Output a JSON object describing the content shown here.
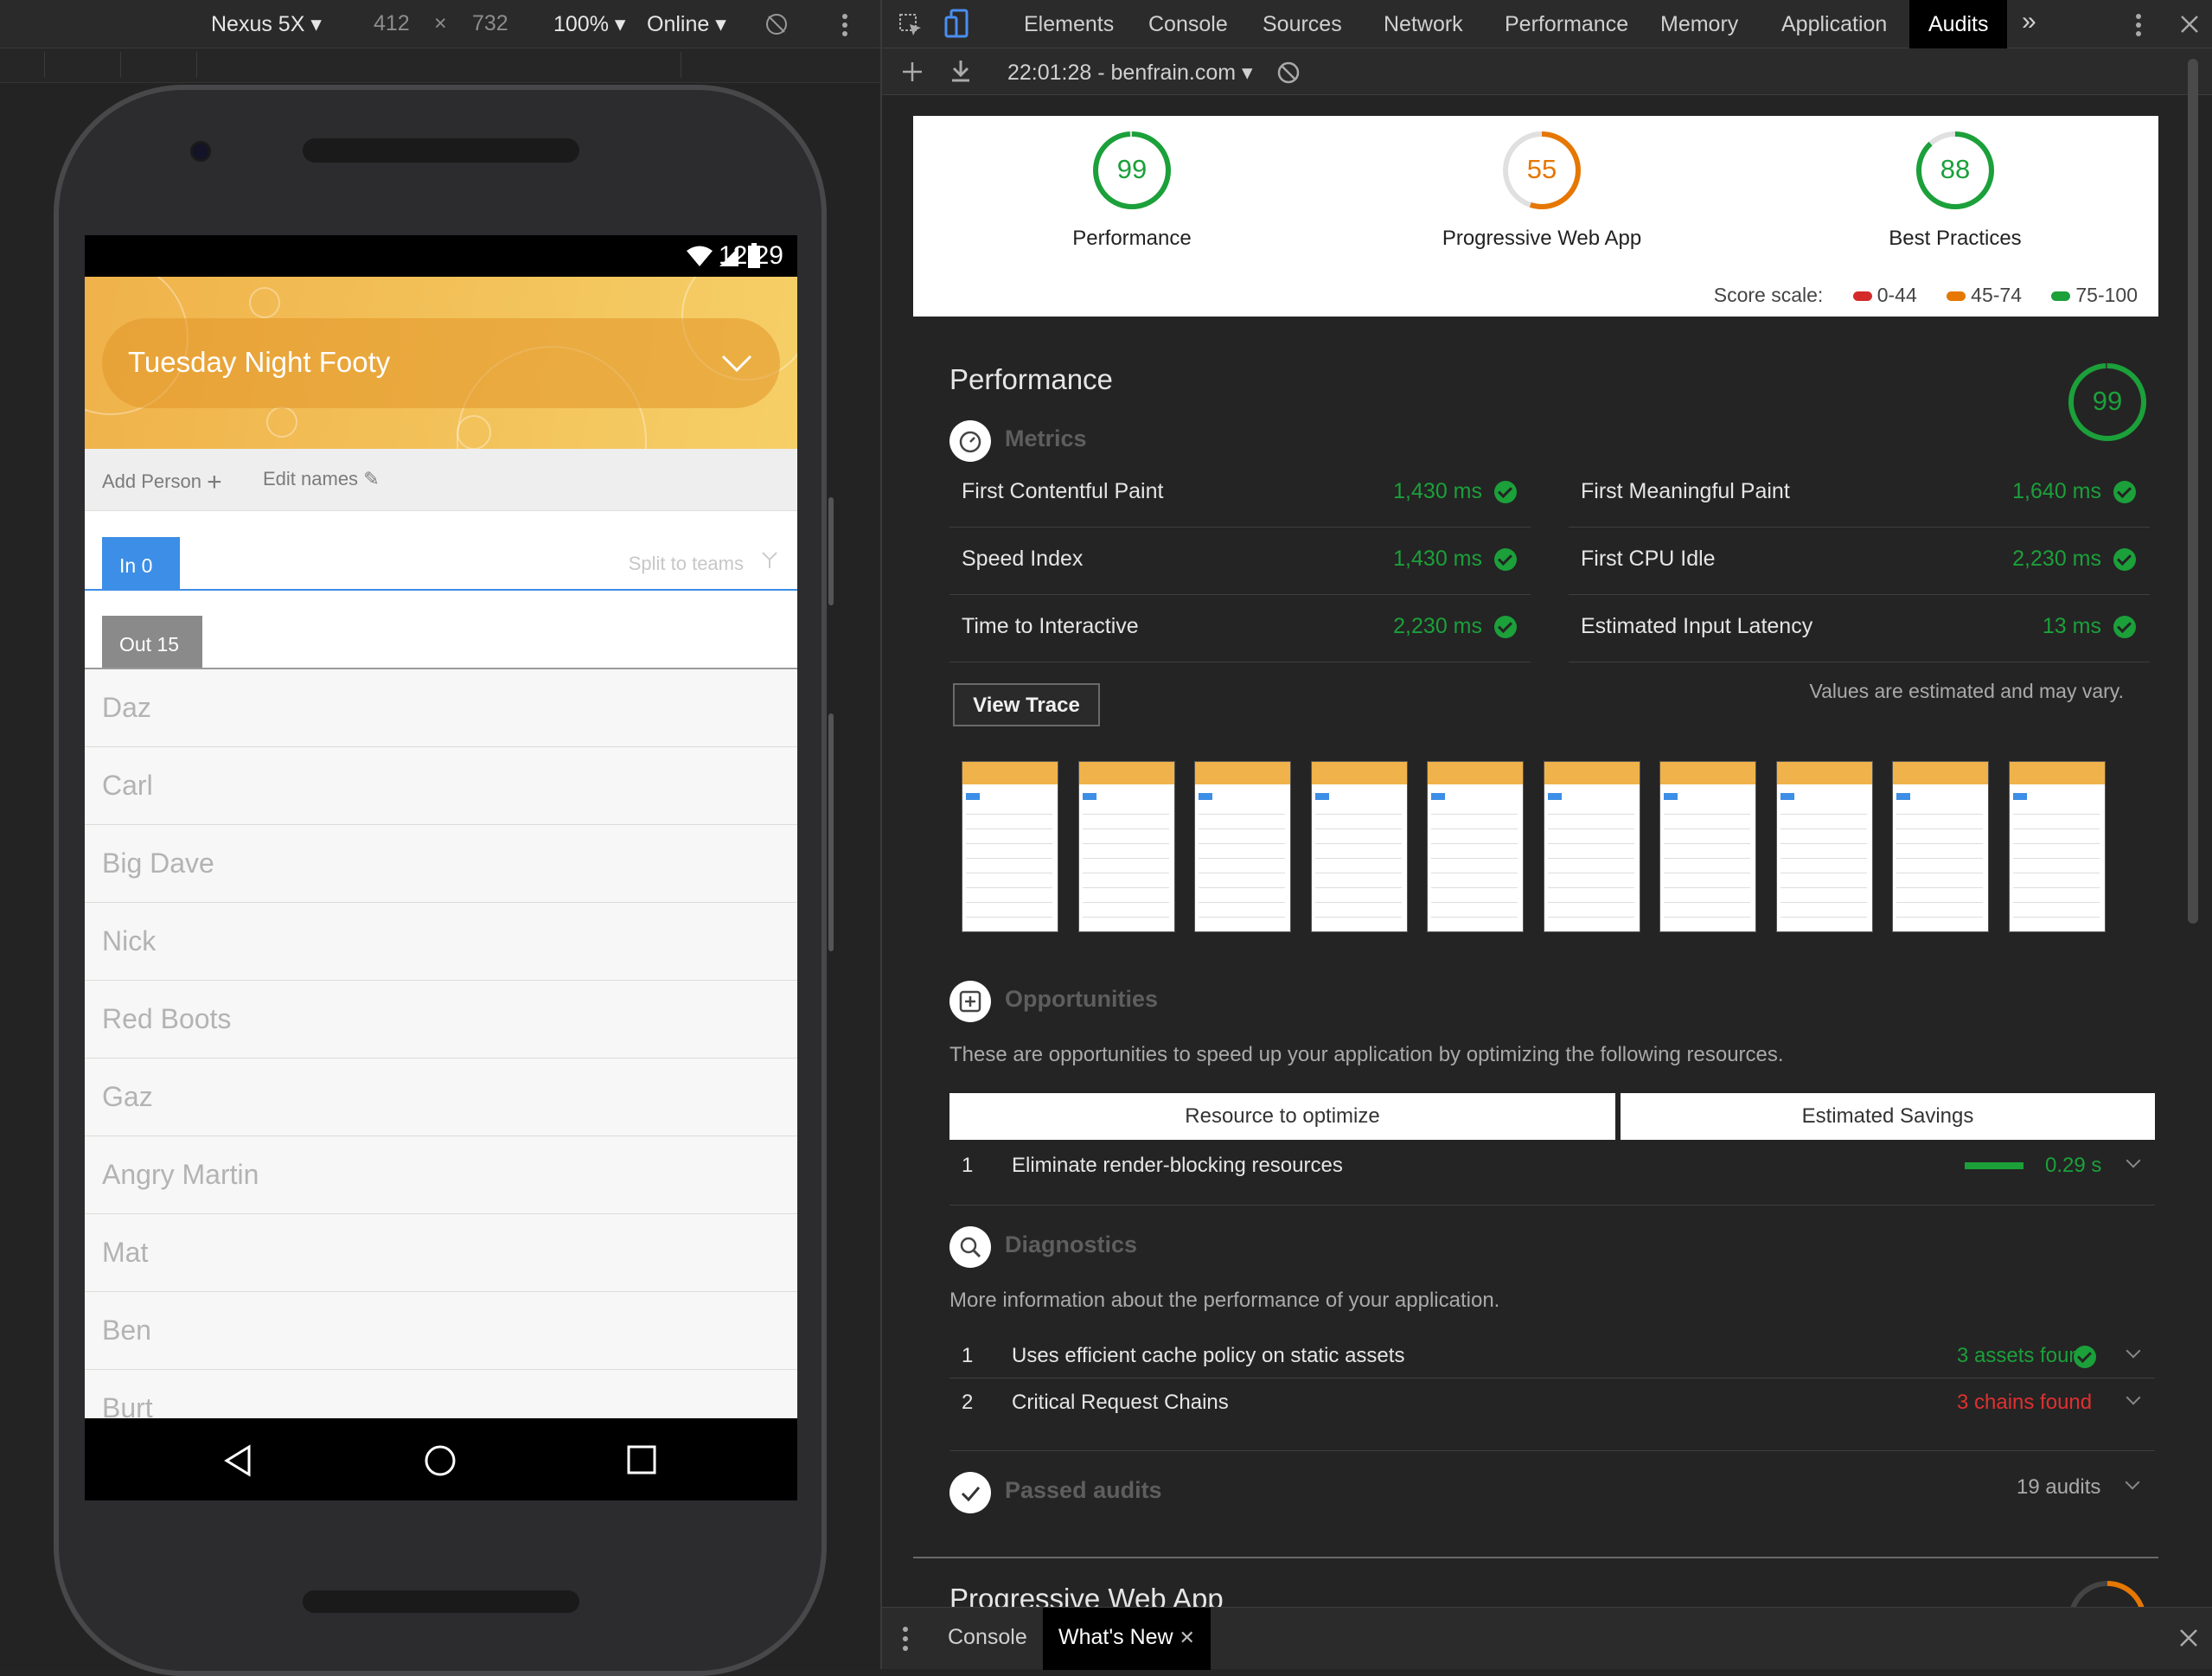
{
  "device_toolbar": {
    "device": "Nexus 5X",
    "width": "412",
    "times": "×",
    "height": "732",
    "zoom": "100%",
    "network": "Online"
  },
  "phone": {
    "status_time": "12:29",
    "team_name": "Tuesday Night Footy",
    "add_person": "Add Person",
    "edit_names": "Edit names",
    "tab_in": "In  0",
    "tab_out": "Out  15",
    "split_to_teams": "Split to teams",
    "people": [
      "Daz",
      "Carl",
      "Big Dave",
      "Nick",
      "Red Boots",
      "Gaz",
      "Angry Martin",
      "Mat",
      "Ben",
      "Burt"
    ]
  },
  "devtools": {
    "tabs": [
      "Elements",
      "Console",
      "Sources",
      "Network",
      "Performance",
      "Memory",
      "Application",
      "Audits"
    ],
    "active_tab": "Audits",
    "more": "»",
    "report_label": "22:01:28 - benfrain.com",
    "colors": {
      "pass": "#1ba03a",
      "average": "#e67700",
      "fail": "#d42a2a"
    }
  },
  "scores": [
    {
      "label": "Performance",
      "value": "99",
      "level": 0.99,
      "color": "#1ba03a"
    },
    {
      "label": "Progressive Web App",
      "value": "55",
      "level": 0.55,
      "color": "#e67700"
    },
    {
      "label": "Best Practices",
      "value": "88",
      "level": 0.88,
      "color": "#1ba03a"
    }
  ],
  "score_scale": {
    "label": "Score scale:",
    "fail": "0-44",
    "average": "45-74",
    "pass": "75-100"
  },
  "performance": {
    "title": "Performance",
    "score": "99",
    "metrics_heading": "Metrics",
    "metrics": [
      {
        "label": "First Contentful Paint",
        "value": "1,430 ms"
      },
      {
        "label": "First Meaningful Paint",
        "value": "1,640 ms"
      },
      {
        "label": "Speed Index",
        "value": "1,430 ms"
      },
      {
        "label": "First CPU Idle",
        "value": "2,230 ms"
      },
      {
        "label": "Time to Interactive",
        "value": "2,230 ms"
      },
      {
        "label": "Estimated Input Latency",
        "value": "13 ms"
      }
    ],
    "view_trace": "View Trace",
    "estimated_note": "Values are estimated and may vary.",
    "opportunities_heading": "Opportunities",
    "opportunities_desc": "These are opportunities to speed up your application by optimizing the following resources.",
    "opp_col_resource": "Resource to optimize",
    "opp_col_savings": "Estimated Savings",
    "opportunities": [
      {
        "num": "1",
        "title": "Eliminate render-blocking resources",
        "savings": "0.29 s"
      }
    ],
    "diagnostics_heading": "Diagnostics",
    "diagnostics_desc": "More information about the performance of your application.",
    "diagnostics": [
      {
        "num": "1",
        "title": "Uses efficient cache policy on static assets",
        "result": "3 assets found"
      },
      {
        "num": "2",
        "title": "Critical Request Chains",
        "result": "3 chains found"
      }
    ],
    "passed_heading": "Passed audits",
    "passed_count": "19 audits"
  },
  "next_section_title": "Progressive Web App",
  "drawer": {
    "tabs": [
      "Console",
      "What's New"
    ],
    "active": "What's New"
  }
}
